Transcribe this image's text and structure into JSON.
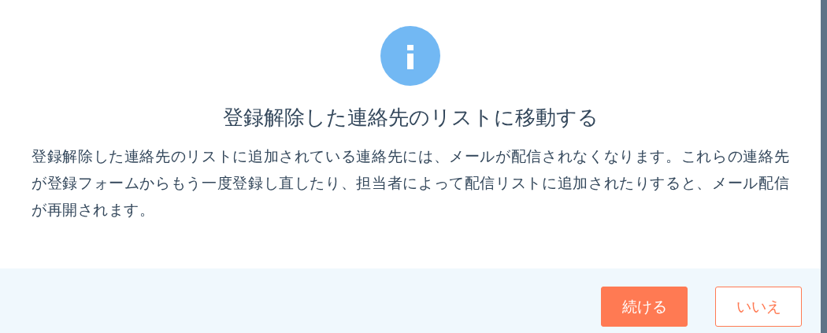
{
  "dialog": {
    "title": "登録解除した連絡先のリストに移動する",
    "message": "登録解除した連絡先のリストに追加されている連絡先には、メールが配信されなくなります。これらの連絡先が登録フォームからもう一度登録し直したり、担当者によって配信リストに追加されたりすると、メール配信が再開されます。",
    "buttons": [
      {
        "label": "続ける",
        "kind": "primary"
      },
      {
        "label": "いいえ",
        "kind": "secondary"
      }
    ]
  }
}
